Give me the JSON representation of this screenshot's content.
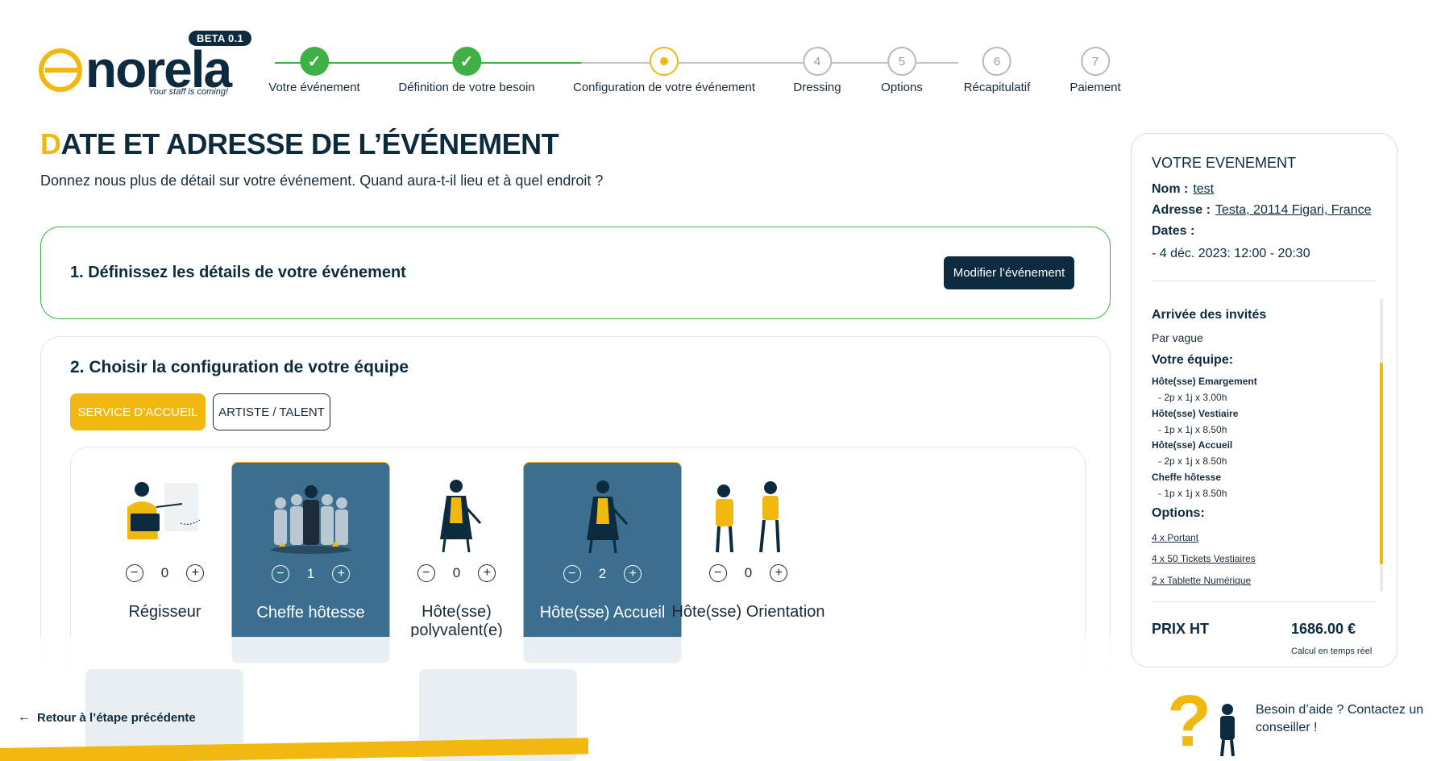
{
  "logo": {
    "beta": "BETA 0.1",
    "word": "norela",
    "tagline": "Your staff is coming!"
  },
  "stepper": {
    "steps": [
      {
        "label": "Votre événement",
        "state": "done",
        "num": "✓"
      },
      {
        "label": "Définition de votre besoin",
        "state": "done",
        "num": "✓"
      },
      {
        "label": "Configuration de votre événement",
        "state": "current",
        "num": ""
      },
      {
        "label": "Dressing",
        "state": "todo",
        "num": "4"
      },
      {
        "label": "Options",
        "state": "todo",
        "num": "5"
      },
      {
        "label": "Récapitulatif",
        "state": "todo",
        "num": "6"
      },
      {
        "label": "Paiement",
        "state": "todo",
        "num": "7"
      }
    ]
  },
  "main": {
    "title_first": "D",
    "title_rest": "ATE ET ADRESSE DE L’ÉVÉNEMENT",
    "subtitle": "Donnez nous plus de détail sur votre événement. Quand aura-t-il lieu et à quel endroit ?",
    "card1": {
      "heading": "1. Définissez les détails de votre événement",
      "button": "Modifier l’événement"
    },
    "card2": {
      "heading": "2. Choisir la configuration de votre équipe",
      "tab_active": "SERVICE D’ACCUEIL",
      "tab_inactive": "ARTISTE / TALENT",
      "roles": [
        {
          "name": "Régisseur",
          "count": "0",
          "selected": false
        },
        {
          "name": "Cheffe hôtesse",
          "count": "1",
          "selected": true
        },
        {
          "name": "Hôte(sse) polyvalent(e)",
          "count": "0",
          "selected": false
        },
        {
          "name": "Hôte(sse) Accueil",
          "count": "2",
          "selected": true
        },
        {
          "name": "Hôte(sse) Orientation",
          "count": "0",
          "selected": false
        }
      ]
    },
    "back": "Retour à l’étape précédente"
  },
  "summary": {
    "title": "VOTRE EVENEMENT",
    "nom_label": "Nom :",
    "nom_value": "test",
    "adresse_label": "Adresse :",
    "adresse_value": "Testa, 20114 Figari, France",
    "dates_label": "Dates :",
    "dates_value": "- 4 déc. 2023: 12:00 - 20:30",
    "arrivee_label": "Arrivée des invités",
    "arrivee_value": "Par vague",
    "equipe_label": "Votre équipe:",
    "equipe": [
      {
        "role": "Hôte(sse) Emargement",
        "detail": "- 2p x 1j x 3.00h"
      },
      {
        "role": "Hôte(sse) Vestiaire",
        "detail": "- 1p x 1j x 8.50h"
      },
      {
        "role": "Hôte(sse) Accueil",
        "detail": "- 2p x 1j x 8.50h"
      },
      {
        "role": "Cheffe hôtesse",
        "detail": "- 1p x 1j x 8.50h"
      }
    ],
    "options_label": "Options:",
    "options": [
      {
        "qty": "4 x",
        "name": "Portant"
      },
      {
        "qty": "4 x",
        "name": "50 Tickets Vestiaires"
      },
      {
        "qty": "2 x",
        "name": "Tablette Numérique"
      }
    ],
    "price_label": "PRIX HT",
    "price_value": "1686.00 €",
    "price_note": "Calcul en temps réel"
  },
  "help": {
    "text": "Besoin d’aide ? Contactez un conseiller !"
  },
  "colors": {
    "accent": "#f1b80f",
    "navy": "#0d2b3e",
    "success": "#3fb045",
    "selected_card": "#3c6e8f"
  }
}
